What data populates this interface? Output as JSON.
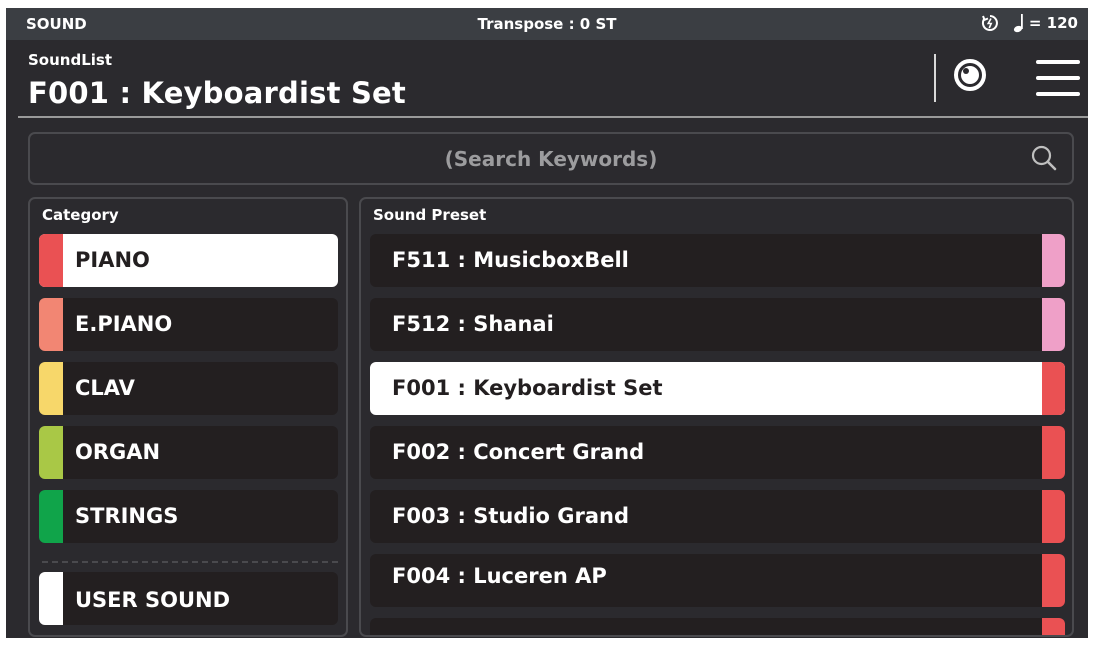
{
  "statusbar": {
    "mode": "SOUND",
    "transpose": "Transpose : 0 ST",
    "tempo": "= 120",
    "icons": [
      "tap-tempo-icon",
      "quarter-note-icon"
    ]
  },
  "header": {
    "subtitle": "SoundList",
    "title": "F001 : Keyboardist Set",
    "icons": [
      "knob-icon",
      "hamburger-menu-icon"
    ]
  },
  "search": {
    "placeholder": "(Search Keywords)",
    "icon": "search-icon"
  },
  "category": {
    "title": "Category",
    "items": [
      {
        "label": "PIANO",
        "color": "#ea5153",
        "selected": true
      },
      {
        "label": "E.PIANO",
        "color": "#f28673",
        "selected": false
      },
      {
        "label": "CLAV",
        "color": "#f7d76a",
        "selected": false
      },
      {
        "label": "ORGAN",
        "color": "#a9c846",
        "selected": false
      },
      {
        "label": "STRINGS",
        "color": "#10a44a",
        "selected": false
      }
    ],
    "user": {
      "label": "USER SOUND",
      "color": "#ffffff"
    }
  },
  "presets": {
    "title": "Sound Preset",
    "items": [
      {
        "label": "F511 : MusicboxBell",
        "color": "#efa0c8",
        "selected": false
      },
      {
        "label": "F512 : Shanai",
        "color": "#efa0c8",
        "selected": false
      },
      {
        "label": "F001 : Keyboardist Set",
        "color": "#ea5153",
        "selected": true
      },
      {
        "label": "F002 : Concert Grand",
        "color": "#ea5153",
        "selected": false
      },
      {
        "label": "F003 : Studio Grand",
        "color": "#ea5153",
        "selected": false
      },
      {
        "label": "F004 : Luceren AP",
        "color": "#ea5153",
        "selected": false
      },
      {
        "label": "",
        "color": "#ea5153",
        "selected": false
      }
    ]
  }
}
